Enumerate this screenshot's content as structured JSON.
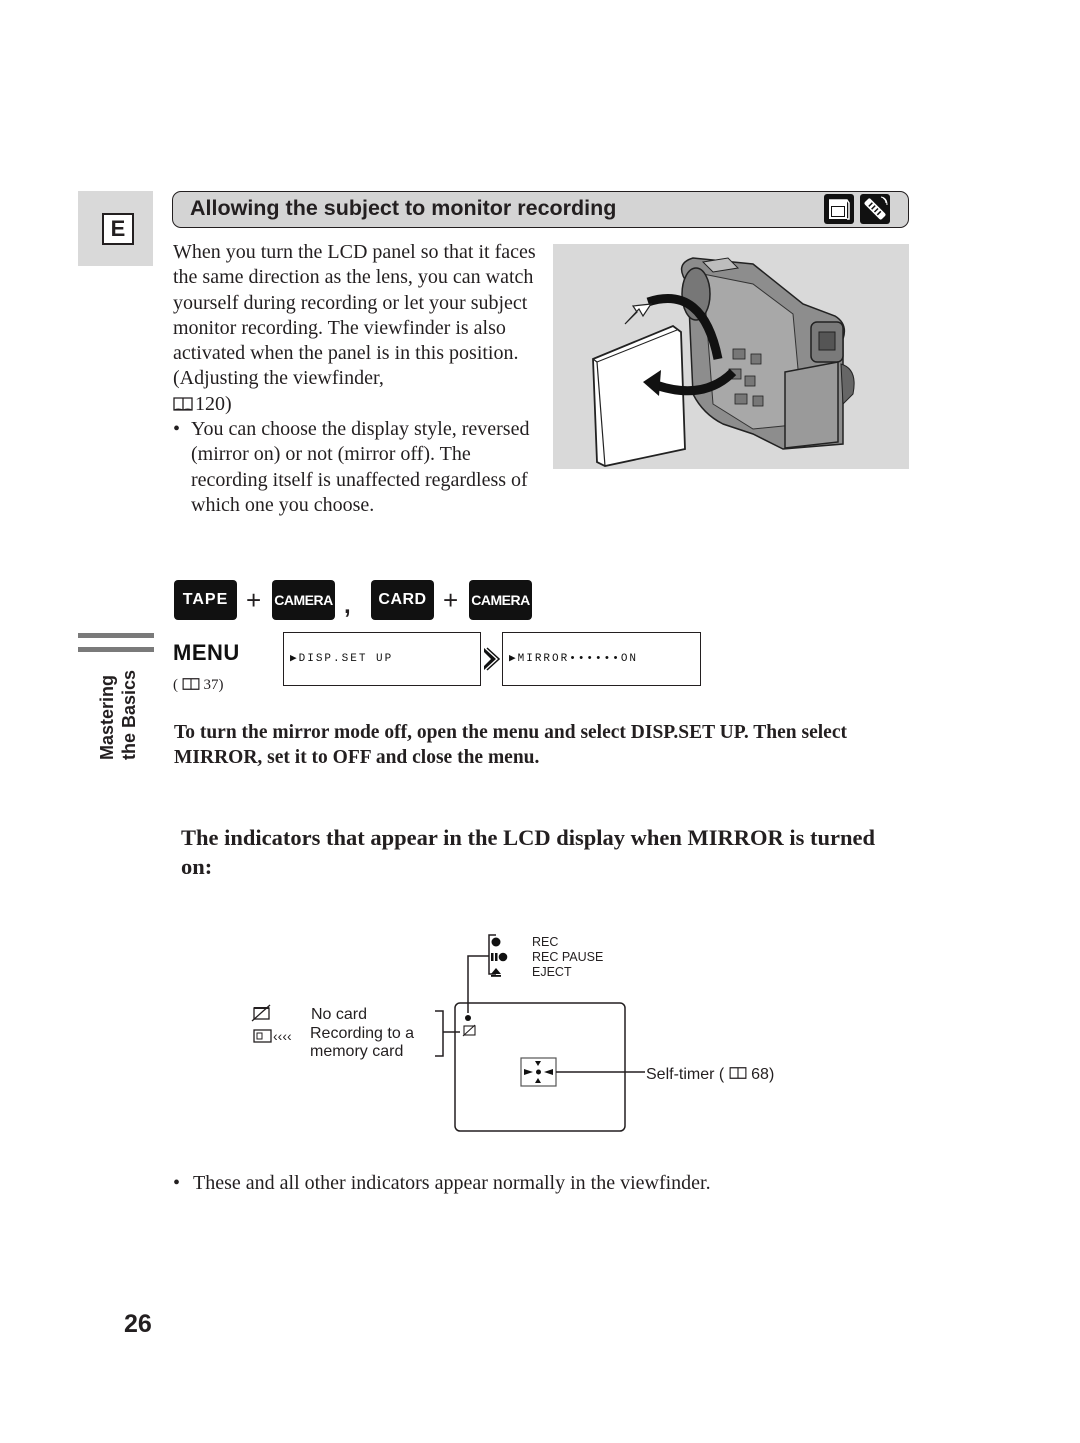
{
  "language_tab": "E",
  "section": {
    "title": "Allowing the subject to monitor recording",
    "icons": [
      "camera-mode-icon",
      "remote-control-icon"
    ]
  },
  "intro": {
    "paragraph": "When you turn the LCD panel so that it faces the same direction as the lens, you can watch yourself during recording or let your subject monitor recording. The viewfinder is also activated when the panel is in this position. (Adjusting the viewfinder,",
    "paragraph_ref": "120)",
    "bullet": "You can choose the display style, reversed (mirror on) or not (mirror off). The recording itself is unaffected regardless of which one you choose."
  },
  "illustration": {
    "description": "camcorder with LCD panel rotated toward the front",
    "icon": "camcorder-lcd-rotate-illustration"
  },
  "modes": {
    "group1": [
      "TAPE",
      "CAMERA"
    ],
    "group2": [
      "CARD",
      "CAMERA"
    ],
    "plus": "+",
    "separator": ","
  },
  "side_tab": {
    "line1": "Mastering",
    "line2": "the Basics"
  },
  "menu": {
    "label": "MENU",
    "ref_open": "(",
    "ref_page": "37)",
    "screen1": "▶DISP.SET UP",
    "screen2": "▶MIRROR••••••ON"
  },
  "instruction": "To turn the mirror mode off, open the menu and select DISP.SET UP. Then select MIRROR, set it to OFF and close the menu.",
  "subheading": "The indicators that appear in the LCD display when MIRROR is turned on:",
  "diagram": {
    "top_indicators": [
      {
        "icon": "rec-dot-icon",
        "label": "REC"
      },
      {
        "icon": "rec-pause-icon",
        "label": "REC PAUSE"
      },
      {
        "icon": "eject-icon",
        "label": "EJECT"
      }
    ],
    "left_indicators": [
      {
        "icon": "no-card-icon",
        "label": "No card"
      },
      {
        "icon": "recording-to-card-icon",
        "label": "Recording to a"
      },
      {
        "icon": "",
        "label": "memory card"
      }
    ],
    "self_timer": {
      "label": "Self-timer (",
      "ref": "68)"
    }
  },
  "footnote": "These and all other indicators appear normally in the viewfinder.",
  "bullet_char": "•",
  "page_number": "26"
}
